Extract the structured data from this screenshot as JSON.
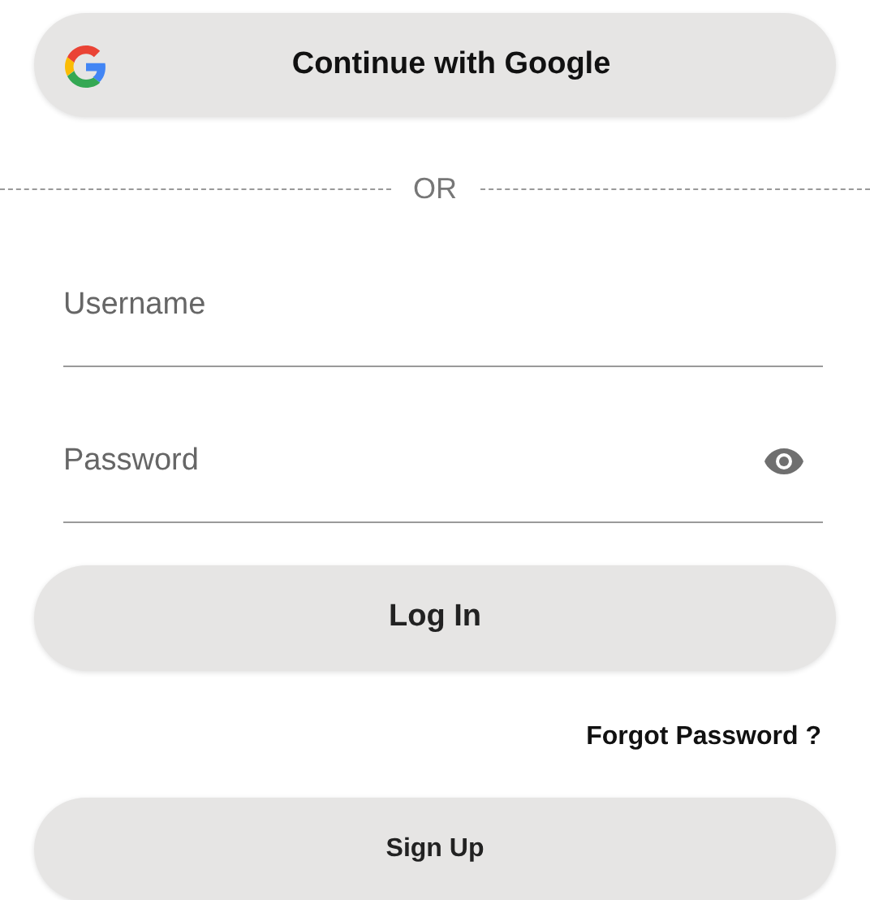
{
  "google_button": {
    "label": "Continue with Google"
  },
  "divider": {
    "label": "OR"
  },
  "fields": [
    {
      "kind": "text",
      "placeholder": "Username"
    },
    {
      "kind": "password",
      "placeholder": "Password"
    }
  ],
  "login_button": {
    "label": "Log In"
  },
  "forgot_link": {
    "label": "Forgot Password ?"
  },
  "signup_button": {
    "label": "Sign Up"
  }
}
